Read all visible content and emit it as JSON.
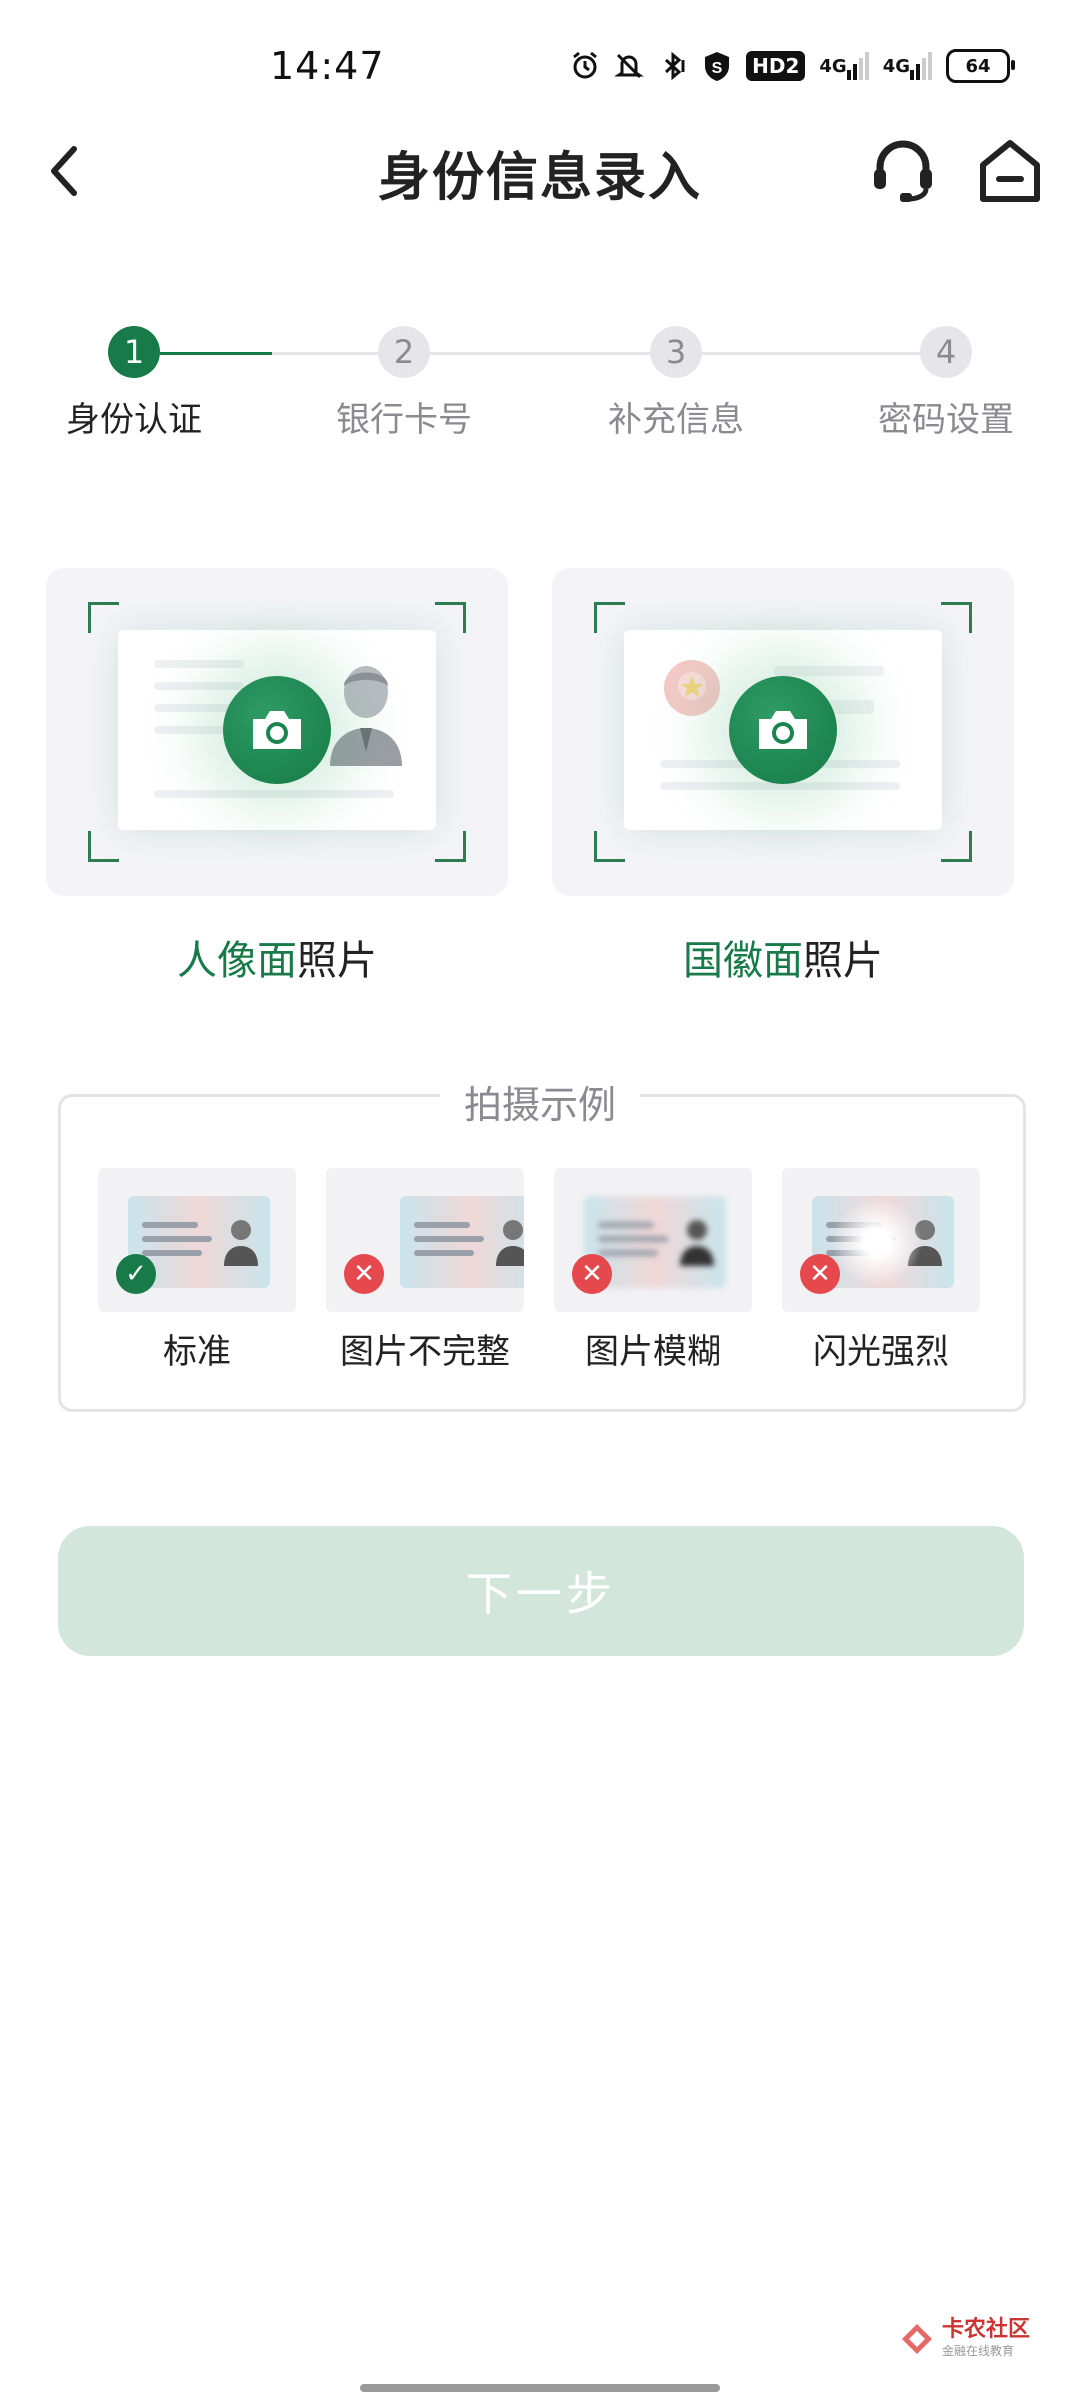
{
  "status_bar": {
    "time": "14:47",
    "icons": [
      "alarm-icon",
      "mute-icon",
      "bluetooth-icon",
      "shield-s-icon",
      "hd-icon",
      "signal-4g-icon",
      "signal-4g-icon",
      "battery-icon"
    ],
    "hd_label": "HD2",
    "net1": "4G",
    "net2": "4G",
    "battery": "64"
  },
  "header": {
    "title": "身份信息录入",
    "back_icon": "back-chevron-icon",
    "service_icon": "headset-icon",
    "home_icon": "home-icon"
  },
  "stepper": {
    "active_color": "#177a48",
    "inactive_color": "#e6e6ea",
    "steps": [
      {
        "num": "1",
        "label": "身份认证",
        "active": true
      },
      {
        "num": "2",
        "label": "银行卡号",
        "active": false
      },
      {
        "num": "3",
        "label": "补充信息",
        "active": false
      },
      {
        "num": "4",
        "label": "密码设置",
        "active": false
      }
    ]
  },
  "upload": {
    "front": {
      "highlight": "人像面",
      "suffix": "照片",
      "icon": "camera-icon"
    },
    "back": {
      "highlight": "国徽面",
      "suffix": "照片",
      "icon": "camera-icon"
    }
  },
  "examples": {
    "title": "拍摄示例",
    "items": [
      {
        "label": "标准",
        "status": "ok"
      },
      {
        "label": "图片不完整",
        "status": "bad"
      },
      {
        "label": "图片模糊",
        "status": "bad"
      },
      {
        "label": "闪光强烈",
        "status": "bad"
      }
    ],
    "ok_color": "#177a48",
    "bad_color": "#e5484d"
  },
  "next_button": {
    "label": "下一步",
    "color": "#d2e6dc"
  },
  "watermark": {
    "text": "卡农社区",
    "sub": "金融在线教育"
  }
}
